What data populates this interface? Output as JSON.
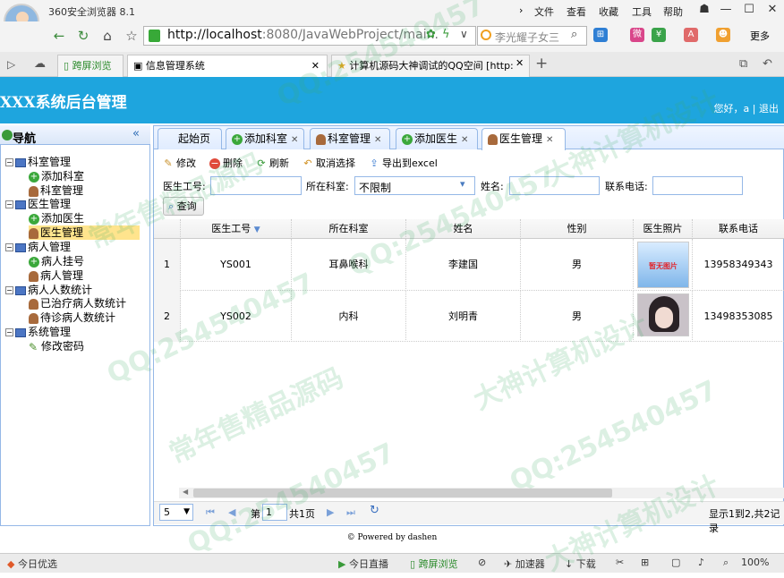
{
  "browser": {
    "name": "360安全浏览器 8.1",
    "menu": [
      "文件",
      "查看",
      "收藏",
      "工具",
      "帮助"
    ],
    "url_host": "http://localhost",
    "url_rest": ":8080/JavaWebProject/main.",
    "search_text": "李光耀子女三",
    "more": "更多",
    "tabs": [
      {
        "label": "跨屏浏览"
      },
      {
        "label": "信息管理系统"
      },
      {
        "label": "计算机源码大神调试的QQ空间 [http:"
      }
    ]
  },
  "app": {
    "title": "XXX系统后台管理",
    "greeting": "您好，a",
    "logout": "退出"
  },
  "nav": {
    "title": "导航",
    "groups": [
      {
        "label": "科室管理",
        "items": [
          "添加科室",
          "科室管理"
        ]
      },
      {
        "label": "医生管理",
        "items": [
          "添加医生",
          "医生管理"
        ]
      },
      {
        "label": "病人管理",
        "items": [
          "病人挂号",
          "病人管理"
        ]
      },
      {
        "label": "病人人数统计",
        "items": [
          "已治疗病人数统计",
          "待诊病人数统计"
        ]
      },
      {
        "label": "系统管理",
        "items": [
          "修改密码"
        ]
      }
    ]
  },
  "tabs": [
    "起始页",
    "添加科室",
    "科室管理",
    "添加医生",
    "医生管理"
  ],
  "toolbar": {
    "edit": "修改",
    "delete": "删除",
    "refresh": "刷新",
    "unselect": "取消选择",
    "export": "导出到excel"
  },
  "search": {
    "id_label": "医生工号:",
    "dept_label": "所在科室:",
    "dept_value": "不限制",
    "name_label": "姓名:",
    "phone_label": "联系电话:",
    "query": "查询"
  },
  "grid": {
    "columns": [
      "医生工号",
      "所在科室",
      "姓名",
      "性别",
      "医生照片",
      "联系电话"
    ],
    "rows": [
      {
        "num": "1",
        "id": "YS001",
        "dept": "耳鼻喉科",
        "name": "李建国",
        "sex": "男",
        "photo": "暂无图片",
        "phone": "13958349343"
      },
      {
        "num": "2",
        "id": "YS002",
        "dept": "内科",
        "name": "刘明青",
        "sex": "男",
        "photo": "",
        "phone": "13498353085"
      }
    ]
  },
  "pager": {
    "page_size": "5",
    "page_prefix": "第",
    "page": "1",
    "page_suffix": "共1页",
    "summary": "显示1到2,共2记录"
  },
  "footer": {
    "powered": "© Powered by dashen"
  },
  "statusbar": {
    "left": "今日优选",
    "live": "今日直播",
    "cross": "跨屏浏览",
    "accel": "加速器",
    "download": "下载",
    "zoom": "100%"
  },
  "watermarks": [
    "QQ:254540457",
    "常年售精品源码",
    "大神计算机设计"
  ]
}
